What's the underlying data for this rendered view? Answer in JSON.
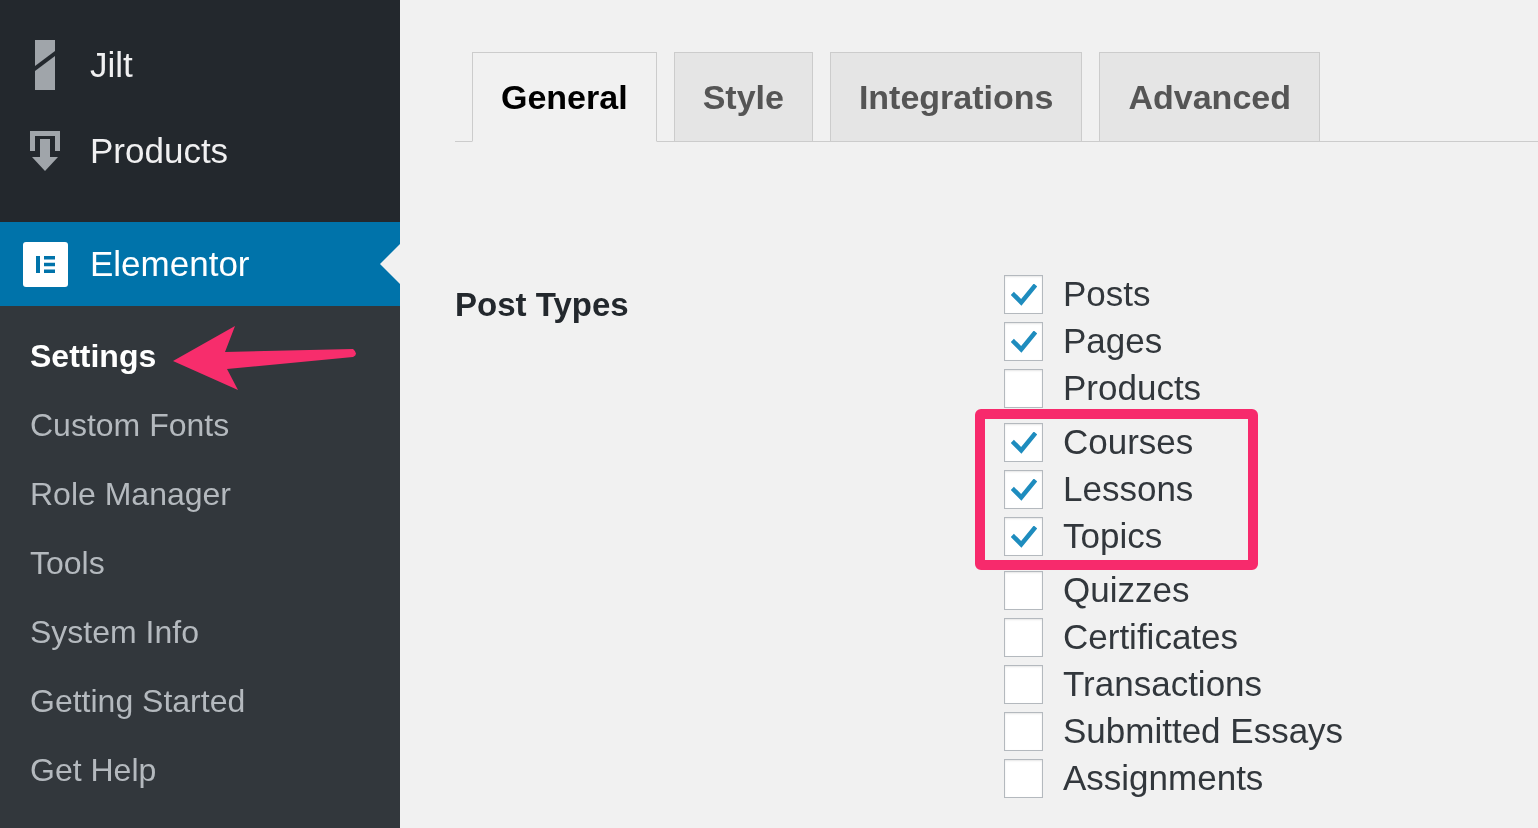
{
  "sidebar": {
    "menu": [
      {
        "label": "Jilt",
        "selected": false
      },
      {
        "label": "Products",
        "selected": false
      },
      {
        "label": "Elementor",
        "selected": true,
        "submenu": [
          {
            "label": "Settings",
            "selected": true,
            "arrow": true
          },
          {
            "label": "Custom Fonts",
            "selected": false,
            "arrow": false
          },
          {
            "label": "Role Manager",
            "selected": false,
            "arrow": false
          },
          {
            "label": "Tools",
            "selected": false,
            "arrow": false
          },
          {
            "label": "System Info",
            "selected": false,
            "arrow": false
          },
          {
            "label": "Getting Started",
            "selected": false,
            "arrow": false
          },
          {
            "label": "Get Help",
            "selected": false,
            "arrow": false
          }
        ]
      }
    ]
  },
  "tabs": [
    {
      "label": "General",
      "selected": true
    },
    {
      "label": "Style",
      "selected": false
    },
    {
      "label": "Integrations",
      "selected": false
    },
    {
      "label": "Advanced",
      "selected": false
    }
  ],
  "post_types": {
    "label": "Post Types",
    "options": [
      {
        "label": "Posts",
        "checked": true,
        "highlighted": false
      },
      {
        "label": "Pages",
        "checked": true,
        "highlighted": false
      },
      {
        "label": "Products",
        "checked": false,
        "highlighted": false
      },
      {
        "label": "Courses",
        "checked": true,
        "highlighted": true
      },
      {
        "label": "Lessons",
        "checked": true,
        "highlighted": true
      },
      {
        "label": "Topics",
        "checked": true,
        "highlighted": true
      },
      {
        "label": "Quizzes",
        "checked": false,
        "highlighted": false
      },
      {
        "label": "Certificates",
        "checked": false,
        "highlighted": false
      },
      {
        "label": "Transactions",
        "checked": false,
        "highlighted": false
      },
      {
        "label": "Submitted Essays",
        "checked": false,
        "highlighted": false
      },
      {
        "label": "Assignments",
        "checked": false,
        "highlighted": false
      }
    ]
  }
}
